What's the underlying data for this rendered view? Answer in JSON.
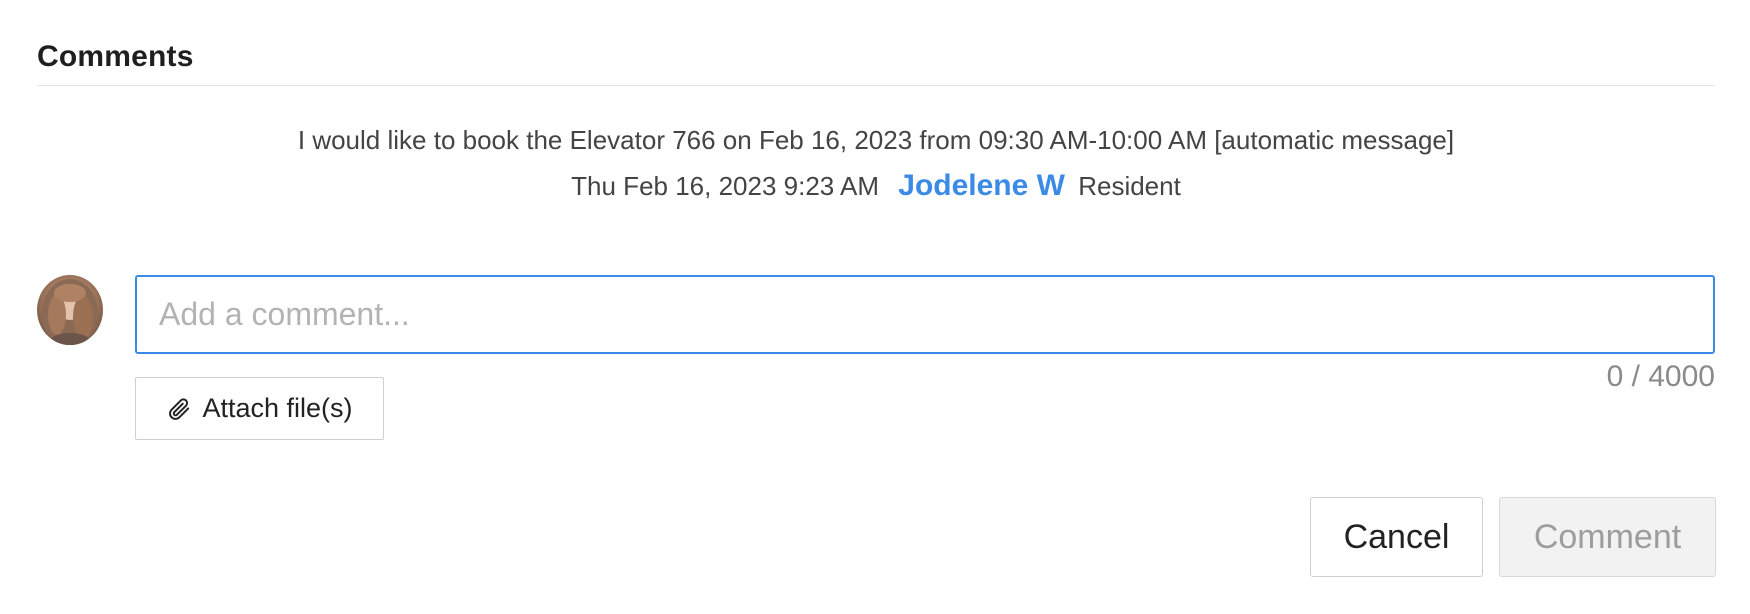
{
  "section": {
    "title": "Comments"
  },
  "comment": {
    "body": "I would like to book the Elevator 766 on Feb 16, 2023 from 09:30 AM-10:00 AM [automatic message]",
    "timestamp": "Thu Feb 16, 2023 9:23 AM",
    "author": "Jodelene W",
    "role": "Resident"
  },
  "composer": {
    "avatar_icon": "user-avatar",
    "input_value": "",
    "input_placeholder": "Add a comment...",
    "char_count": "0 / 4000",
    "attach_label": "Attach file(s)",
    "attach_icon": "paperclip-icon",
    "focus_color": "#3b8ae6"
  },
  "actions": {
    "cancel_label": "Cancel",
    "comment_label": "Comment",
    "comment_enabled": false
  },
  "colors": {
    "link": "#3b8ae6",
    "disabled_bg": "#f2f2f2",
    "disabled_text": "#9d9d9d"
  }
}
